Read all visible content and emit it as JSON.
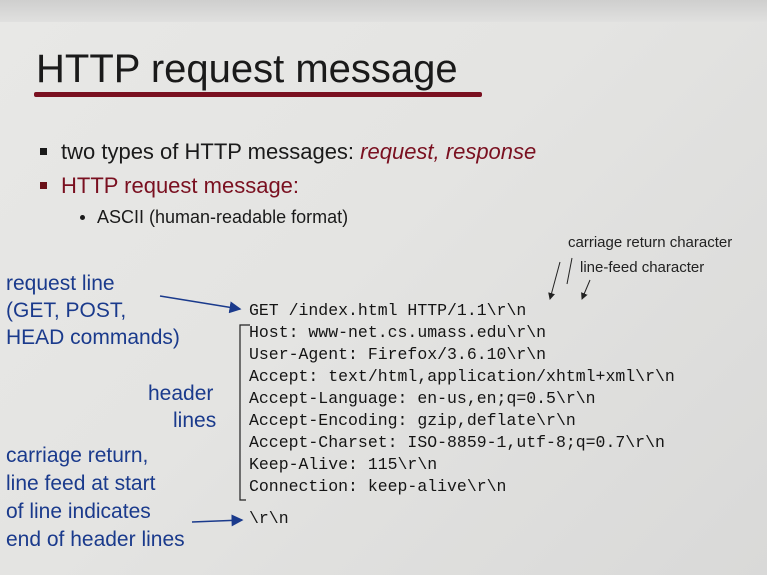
{
  "slide": {
    "title": "HTTP request message",
    "bullet1_prefix": "two types of HTTP messages: ",
    "bullet1_emph": "request, response",
    "bullet2": "HTTP request message:",
    "sub_bullet": "ASCII (human-readable format)"
  },
  "annotations": {
    "cr_char": "carriage return character",
    "lf_char": "line-feed character",
    "request_line": [
      "request line",
      "(GET, POST,",
      "HEAD commands)"
    ],
    "header_lines": [
      "header",
      "lines"
    ],
    "crlf_note": [
      "carriage return,",
      "line feed at start",
      "of line indicates",
      "end of header lines"
    ]
  },
  "request_lines": [
    "GET /index.html HTTP/1.1\\r\\n",
    "Host: www-net.cs.umass.edu\\r\\n",
    "User-Agent: Firefox/3.6.10\\r\\n",
    "Accept: text/html,application/xhtml+xml\\r\\n",
    "Accept-Language: en-us,en;q=0.5\\r\\n",
    "Accept-Encoding: gzip,deflate\\r\\n",
    "Accept-Charset: ISO-8859-1,utf-8;q=0.7\\r\\n",
    "Keep-Alive: 115\\r\\n",
    "Connection: keep-alive\\r\\n",
    "\\r\\n"
  ],
  "colors": {
    "title_underline": "#7a1020",
    "emphasis": "#7a1020",
    "annotation_blue": "#1a3a8c"
  }
}
